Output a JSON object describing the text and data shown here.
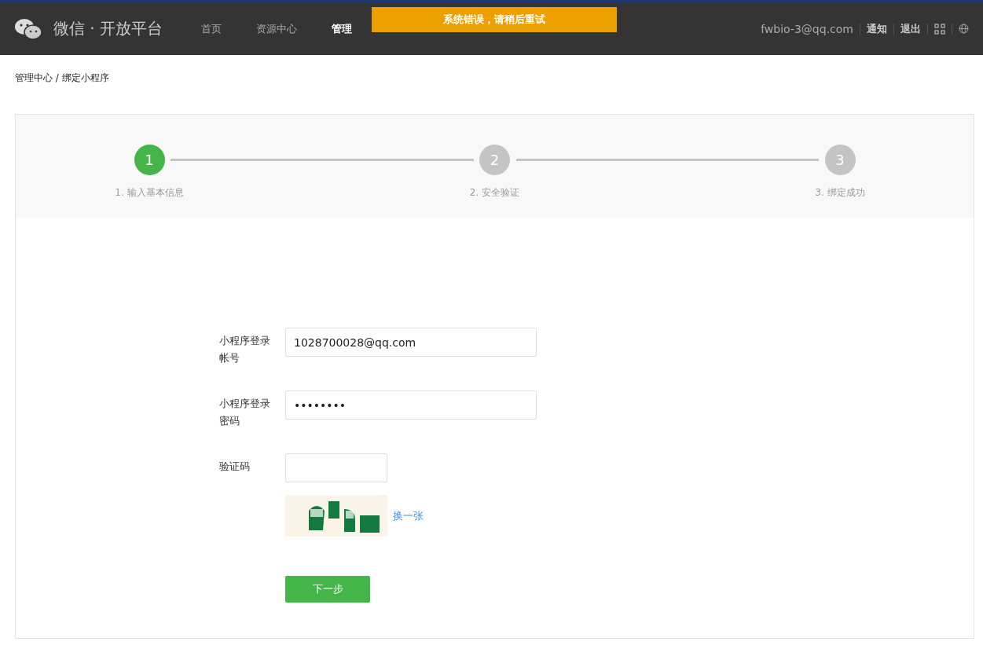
{
  "header": {
    "logo_text": "微信 · 开放平台",
    "nav": [
      {
        "label": "首页",
        "selected": false
      },
      {
        "label": "资源中心",
        "selected": false
      },
      {
        "label": "管理",
        "selected": true
      }
    ],
    "account": "fwbio-3@qq.com",
    "links": [
      "通知",
      "退出"
    ]
  },
  "toast": {
    "message": "系统错误，请稍后重试"
  },
  "breadcrumb": "管理中心 / 绑定小程序",
  "steps": [
    {
      "number": "1",
      "label": "1. 输入基本信息",
      "selected": true
    },
    {
      "number": "2",
      "label": "2. 安全验证",
      "selected": false
    },
    {
      "number": "3",
      "label": "3. 绑定成功",
      "selected": false
    }
  ],
  "form": {
    "fields": [
      {
        "kind": "text",
        "label": "小程序登录帐号",
        "value": "1028700028@qq.com"
      },
      {
        "kind": "password",
        "label": "小程序登录密码",
        "value": "••••••••"
      },
      {
        "kind": "captcha",
        "label": "验证码"
      }
    ],
    "captcha": {
      "kind": "picture",
      "refresh_link": "换一张"
    },
    "submit": "下一步"
  }
}
